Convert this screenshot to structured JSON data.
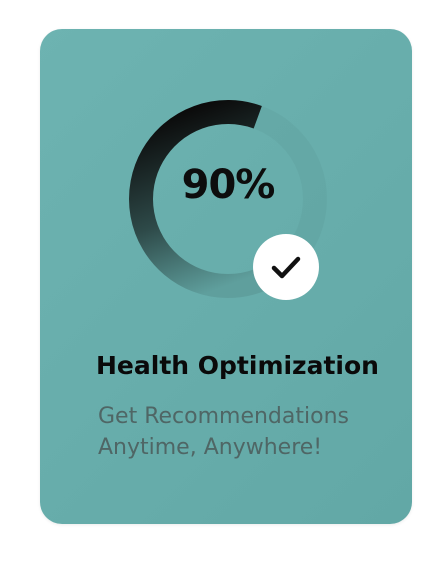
{
  "progress": {
    "value": 0.9,
    "label": "90%",
    "complete": true
  },
  "card": {
    "title": "Health Optimization",
    "subtitle": "Get Recommendations Anytime, Anywhere!"
  },
  "colors": {
    "card_background": "#66adab",
    "ring_dark": "#0b0b0b",
    "ring_light": "#5d9e9c",
    "badge": "#ffffff"
  },
  "icons": {
    "badge": "checkmark-icon"
  }
}
